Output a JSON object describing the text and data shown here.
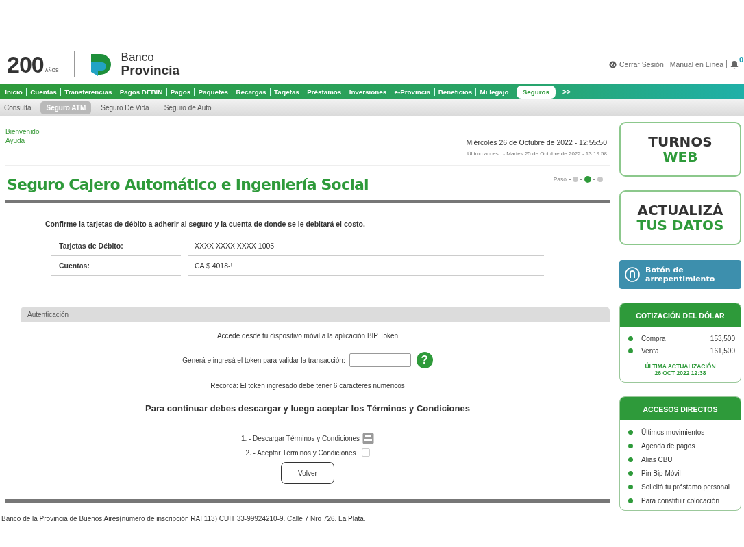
{
  "header": {
    "logo_number": "200",
    "logo_years": "AÑOS",
    "bank_line1": "Banco",
    "bank_line2": "Provincia",
    "links": [
      "Cerrar Sesión",
      "Manual en Línea"
    ],
    "notifications": "0"
  },
  "nav": {
    "items": [
      {
        "label": "Inicio",
        "selected": false
      },
      {
        "label": "Cuentas",
        "selected": false
      },
      {
        "label": "Transferencias",
        "selected": false
      },
      {
        "label": "Pagos DEBIN",
        "selected": false
      },
      {
        "label": "Pagos",
        "selected": false
      },
      {
        "label": "Paquetes",
        "selected": false
      },
      {
        "label": "Recargas",
        "selected": false
      },
      {
        "label": "Tarjetas",
        "selected": false
      },
      {
        "label": "Préstamos",
        "selected": false
      },
      {
        "label": "Inversiones",
        "selected": false
      },
      {
        "label": "e-Provincia",
        "selected": false
      },
      {
        "label": "Beneficios",
        "selected": false
      },
      {
        "label": "Mi legajo",
        "selected": false
      },
      {
        "label": "Seguros",
        "selected": true
      }
    ],
    "more": ">>"
  },
  "subnav": [
    {
      "label": "Consulta",
      "selected": false
    },
    {
      "label": "Seguro ATM",
      "selected": true
    },
    {
      "label": "Seguro De Vida",
      "selected": false
    },
    {
      "label": "Seguro de Auto",
      "selected": false
    }
  ],
  "welcome": "Bienvenido",
  "help": "Ayuda",
  "date": "Miércoles 26 de Octubre de 2022 - 12:55:50",
  "last_access": "Último acceso - Martes 25 de Octubre de 2022 - 13:19:58",
  "page_title": "Seguro Cajero Automático e Ingeniería Social",
  "steps": {
    "label": "Paso",
    "dots": [
      {
        "selected": false
      },
      {
        "selected": true
      },
      {
        "selected": false
      }
    ]
  },
  "intro": "Confirme la tarjetas de débito a adherir al seguro y la cuenta de donde se le debitará el costo.",
  "details": [
    {
      "label": "Tarjetas de Débito:",
      "value": "XXXX XXXX XXXX 1005"
    },
    {
      "label": "Cuentas:",
      "value": "CA $  4018-!"
    }
  ],
  "auth": {
    "title": "Autenticación",
    "instruction": "Accedé desde tu dispositivo móvil a la aplicación BIP Token",
    "token_label": "Generá e ingresá el token para validar la transacción:",
    "help_mark": "?",
    "reminder": "Recordá: El token ingresado debe tener 6 caracteres numéricos"
  },
  "terms": {
    "heading": "Para continuar debes descargar y luego aceptar los Términos y Condiciones",
    "download": "1. - Descargar Términos y Condiciones",
    "accept": "2. - Aceptar Términos y Condiciones",
    "accepted": false
  },
  "back_button": "Volver",
  "footer": "Banco de la Provincia de Buenos Aires(número de inscripción RAI 113) CUIT 33-99924210-9. Calle 7 Nro 726. La Plata.",
  "sidebar": {
    "turnos": [
      "TURNOS",
      "WEB"
    ],
    "update_data": [
      "ACTUALIZÁ",
      "TUS DATOS"
    ],
    "regret": "Botón de arrepentimiento",
    "dollar": {
      "title": "COTIZACIÓN DEL DÓLAR",
      "rates": [
        {
          "label": "Compra",
          "value": "153,500"
        },
        {
          "label": "Venta",
          "value": "161,500"
        }
      ],
      "updated": "ÚLTIMA ACTUALIZACIÓN",
      "updated_at": "26 OCT 2022 12:38"
    },
    "shortcuts": {
      "title": "ACCESOS DIRECTOS",
      "items": [
        "Últimos movimientos",
        "Agenda de pagos",
        "Alias CBU",
        "Pin Bip Móvil",
        "Solicitá tu préstamo personal",
        "Para constituir colocación"
      ]
    }
  }
}
